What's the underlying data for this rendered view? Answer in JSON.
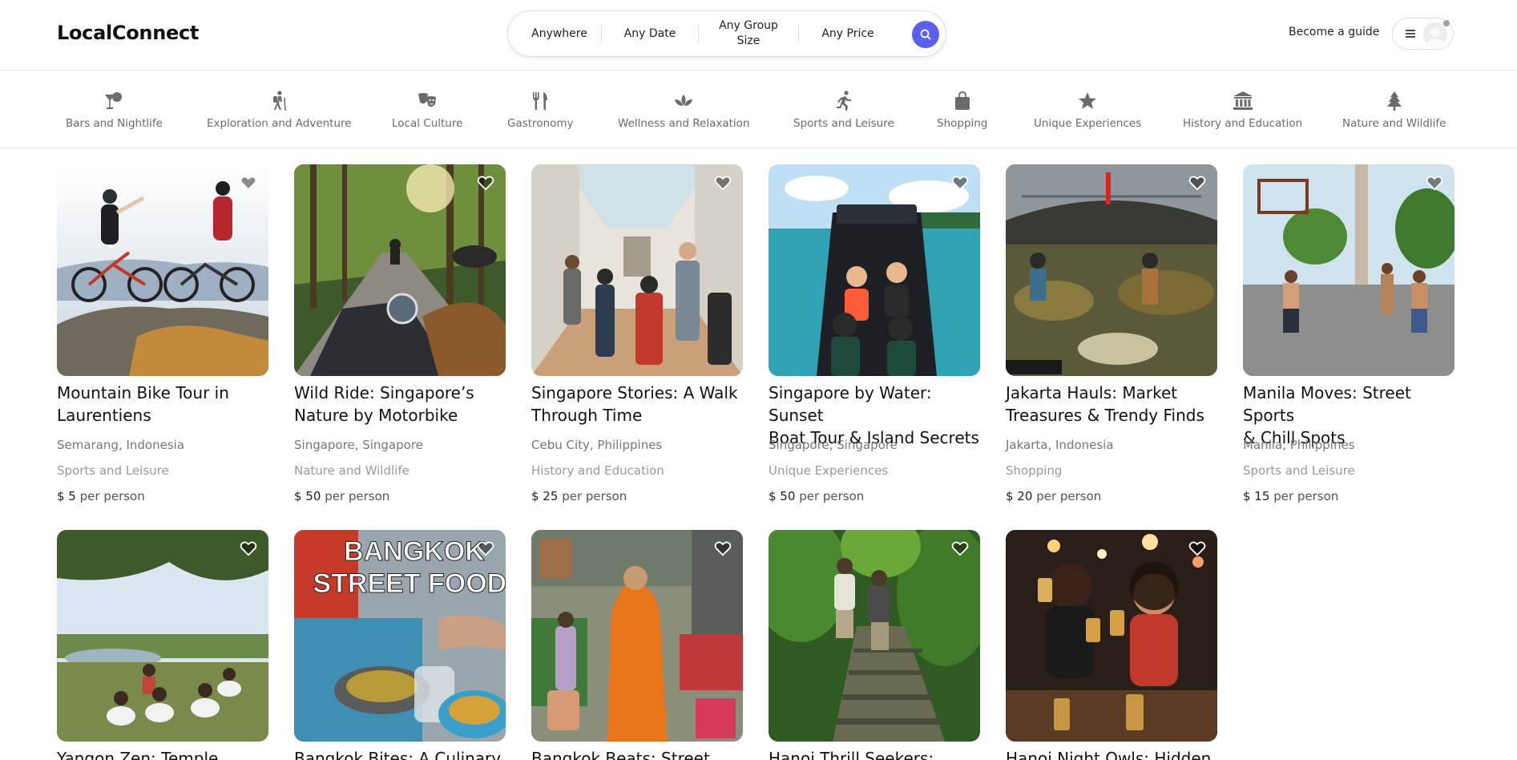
{
  "app": {
    "logo": "LocalConnect"
  },
  "search": {
    "where": "Anywhere",
    "date": "Any Date",
    "group_line1": "Any Group",
    "group_line2": "Size",
    "price": "Any Price"
  },
  "header": {
    "become_guide": "Become a guide"
  },
  "categories": [
    {
      "label": "Bars and Nightlife",
      "icon": "cocktail-icon"
    },
    {
      "label": "Exploration and Adventure",
      "icon": "hiker-icon"
    },
    {
      "label": "Local Culture",
      "icon": "theater-masks-icon"
    },
    {
      "label": "Gastronomy",
      "icon": "utensils-icon"
    },
    {
      "label": "Wellness and Relaxation",
      "icon": "lotus-icon"
    },
    {
      "label": "Sports and Leisure",
      "icon": "runner-icon"
    },
    {
      "label": "Shopping",
      "icon": "shopping-bag-icon"
    },
    {
      "label": "Unique Experiences",
      "icon": "star-icon"
    },
    {
      "label": "History and Education",
      "icon": "museum-icon"
    },
    {
      "label": "Nature and Wildlife",
      "icon": "tree-icon"
    }
  ],
  "listings": [
    {
      "title_1": "Mountain Bike Tour in",
      "title_2": "Laurentiens",
      "location": "Semarang, Indonesia",
      "category": "Sports and Leisure",
      "price": "$ 5",
      "per": "per person"
    },
    {
      "title_1": "Wild Ride: Singapore’s",
      "title_2": "Nature by Motorbike",
      "location": "Singapore, Singapore",
      "category": "Nature and Wildlife",
      "price": "$ 50",
      "per": "per person"
    },
    {
      "title_1": "Singapore Stories: A Walk",
      "title_2": "Through Time",
      "location": "Cebu City, Philippines",
      "category": "History and Education",
      "price": "$ 25",
      "per": "per person"
    },
    {
      "title_1": "Singapore by Water: Sunset",
      "title_2": "Boat Tour & Island Secrets",
      "location": "Singapore, Singapore",
      "category": "Unique Experiences",
      "price": "$ 50",
      "per": "per person"
    },
    {
      "title_1": "Jakarta Hauls: Market",
      "title_2": "Treasures & Trendy Finds",
      "location": "Jakarta, Indonesia",
      "category": "Shopping",
      "price": "$ 20",
      "per": "per person"
    },
    {
      "title_1": "Manila Moves: Street Sports",
      "title_2": "& Chill Spots",
      "location": "Manila, Philippines",
      "category": "Sports and Leisure",
      "price": "$ 15",
      "per": "per person"
    },
    {
      "title_1": "Yangon Zen: Temple",
      "title_2": "",
      "location": "",
      "category": "",
      "price": "",
      "per": ""
    },
    {
      "title_1": "Bangkok Bites: A Culinary",
      "title_2": "",
      "location": "",
      "category": "",
      "price": "",
      "per": "",
      "image_text_1": "BANGKOK",
      "image_text_2": "STREET FOOD!"
    },
    {
      "title_1": "Bangkok Beats: Street Food",
      "title_2": "",
      "location": "",
      "category": "",
      "price": "",
      "per": ""
    },
    {
      "title_1": "Hanoi Thrill Seekers: Urban",
      "title_2": "",
      "location": "",
      "category": "",
      "price": "",
      "per": ""
    },
    {
      "title_1": "Hanoi Night Owls: Hidden",
      "title_2": "",
      "location": "",
      "category": "",
      "price": "",
      "per": ""
    }
  ],
  "colors": {
    "accent": "#5b5fef",
    "text": "#222222",
    "muted": "#777777",
    "border": "#ebebeb"
  }
}
